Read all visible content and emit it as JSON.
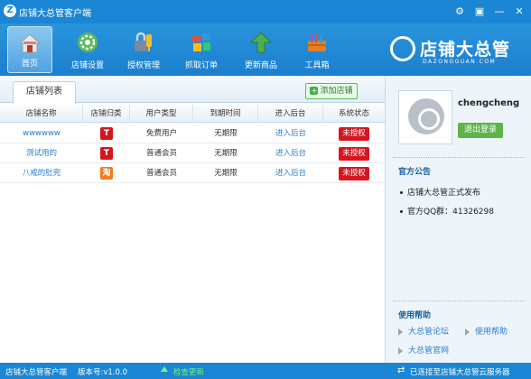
{
  "window": {
    "title": "店铺大总管客户端",
    "logo_letter": "Z",
    "controls": {
      "settings_icon": "⚙",
      "skin_icon": "▣",
      "minimize_icon": "—",
      "close_icon": "✕"
    }
  },
  "toolbar": {
    "items": [
      {
        "label": "首页",
        "icon": "home-icon",
        "active": true
      },
      {
        "label": "店铺设置",
        "icon": "gear-icon",
        "active": false
      },
      {
        "label": "授权管理",
        "icon": "lock-key-icon",
        "active": false
      },
      {
        "label": "抓取订单",
        "icon": "capture-order-icon",
        "active": false
      },
      {
        "label": "更新商品",
        "icon": "up-arrow-icon",
        "active": false
      },
      {
        "label": "工具箱",
        "icon": "toolbox-icon",
        "active": false
      }
    ]
  },
  "brand": {
    "name": "店铺大总管",
    "domain": "DAZONGGUAN.COM"
  },
  "main": {
    "tab_label": "店铺列表",
    "add_button": "添加店铺",
    "columns": [
      "店铺名称",
      "店铺归类",
      "用户类型",
      "到期时间",
      "进入后台",
      "系统状态"
    ],
    "rows": [
      {
        "name": "wwwwww",
        "category": "T",
        "category_type": "tmall",
        "user_type": "免费用户",
        "expiry": "无期限",
        "backend": "进入后台",
        "status": "未授权"
      },
      {
        "name": "测试用的",
        "category": "T",
        "category_type": "tmall",
        "user_type": "普通会员",
        "expiry": "无期限",
        "backend": "进入后台",
        "status": "未授权"
      },
      {
        "name": "八戒的肚兜",
        "category": "淘",
        "category_type": "taobao",
        "user_type": "普通会员",
        "expiry": "无期限",
        "backend": "进入后台",
        "status": "未授权"
      }
    ]
  },
  "side": {
    "username": "chengcheng",
    "logout": "退出登录",
    "notice_title": "官方公告",
    "notices": [
      "店铺大总管正式发布",
      "官方QQ群：41326298"
    ],
    "help_title": "使用帮助",
    "help_links": [
      "大总管论坛",
      "使用帮助",
      "大总管官网"
    ]
  },
  "statusbar": {
    "app_name": "店铺大总管客户端",
    "version": "版本号:v1.0.0",
    "update": "检查更新",
    "connection": "已连接至店铺大总管云服务器"
  },
  "colors": {
    "primary": "#1a86d4",
    "danger": "#d8151f",
    "success": "#5db449",
    "link": "#2c7bd0"
  }
}
